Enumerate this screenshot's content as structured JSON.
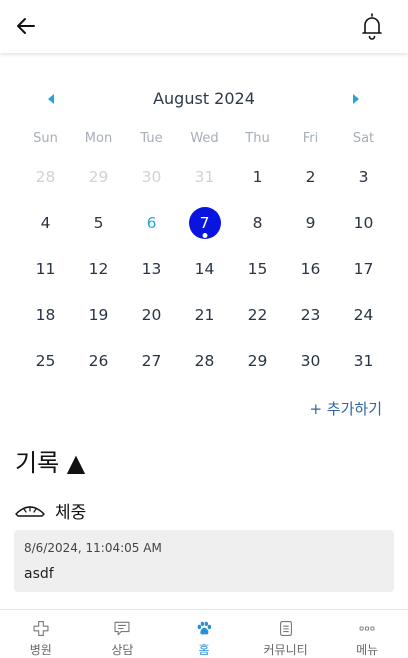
{
  "calendar": {
    "month_title": "August 2024",
    "weekdays": [
      "Sun",
      "Mon",
      "Tue",
      "Wed",
      "Thu",
      "Fri",
      "Sat"
    ],
    "weeks": [
      [
        "28",
        "29",
        "30",
        "31",
        "1",
        "2",
        "3"
      ],
      [
        "4",
        "5",
        "6",
        "7",
        "8",
        "9",
        "10"
      ],
      [
        "11",
        "12",
        "13",
        "14",
        "15",
        "16",
        "17"
      ],
      [
        "18",
        "19",
        "20",
        "21",
        "22",
        "23",
        "24"
      ],
      [
        "25",
        "26",
        "27",
        "28",
        "29",
        "30",
        "31"
      ]
    ],
    "today": "6",
    "selected": "7",
    "add_label": "+ 추가하기"
  },
  "records": {
    "title": "기록 ▲",
    "category_label": "체중",
    "entries": [
      {
        "timestamp": "8/6/2024, 11:04:05 AM",
        "text": "asdf"
      }
    ]
  },
  "bottom_nav": [
    {
      "label": "병원",
      "icon": "hospital-cross-icon"
    },
    {
      "label": "상담",
      "icon": "chat-icon"
    },
    {
      "label": "홈",
      "icon": "paw-icon",
      "active": true
    },
    {
      "label": "커뮤니티",
      "icon": "document-icon"
    },
    {
      "label": "메뉴",
      "icon": "more-icon"
    }
  ],
  "colors": {
    "selected_day": "#0a14e0",
    "today": "#2aa3d8",
    "link": "#2e65a8",
    "nav_active": "#2a8fd4"
  }
}
